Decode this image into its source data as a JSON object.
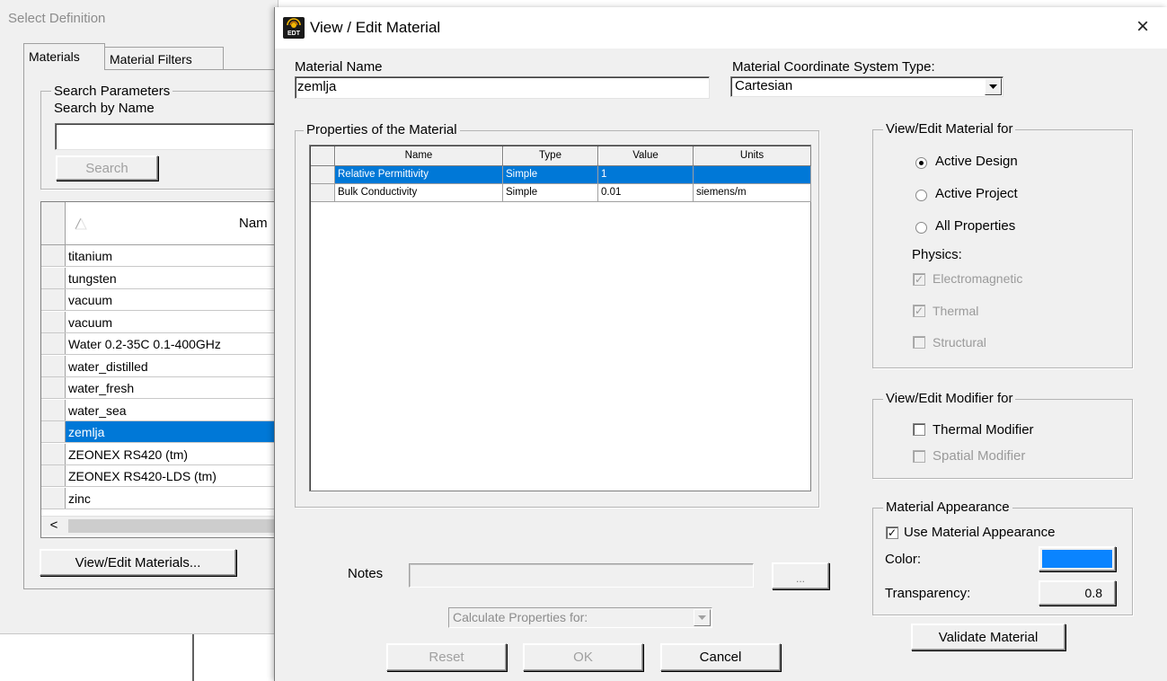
{
  "background_dialog": {
    "title": "Select Definition",
    "tabs": [
      {
        "label": "Materials"
      },
      {
        "label": "Material Filters"
      }
    ],
    "search_group": {
      "label": "Search Parameters",
      "search_by_name": "Search by Name",
      "search_input_value": "",
      "search_button": "Search"
    },
    "materials_table": {
      "name_header": "Nam",
      "rows": [
        {
          "name": "titanium"
        },
        {
          "name": "tungsten"
        },
        {
          "name": "vacuum"
        },
        {
          "name": "vacuum"
        },
        {
          "name": "Water 0.2-35C 0.1-400GHz"
        },
        {
          "name": "water_distilled"
        },
        {
          "name": "water_fresh"
        },
        {
          "name": "water_sea"
        },
        {
          "name": "zemlja",
          "selected": true
        },
        {
          "name": "ZEONEX RS420 (tm)"
        },
        {
          "name": "ZEONEX RS420-LDS (tm)"
        },
        {
          "name": "zinc"
        }
      ],
      "scroll_left_glyph": "<"
    },
    "view_edit_button": "View/Edit Materials..."
  },
  "dialog": {
    "title": "View / Edit Material",
    "app_icon_text": "EDT",
    "close_glyph": "×",
    "material_name_label": "Material Name",
    "material_name_value": "zemlja",
    "coord_label": "Material Coordinate System Type:",
    "coord_value": "Cartesian",
    "properties_group_label": "Properties of the Material",
    "properties_table": {
      "headers": [
        "Name",
        "Type",
        "Value",
        "Units"
      ],
      "rows": [
        {
          "name": "Relative Permittivity",
          "type": "Simple",
          "value": "1",
          "units": "",
          "selected": true
        },
        {
          "name": "Bulk Conductivity",
          "type": "Simple",
          "value": "0.01",
          "units": "siemens/m",
          "selected": false
        }
      ]
    },
    "view_edit_for": {
      "label": "View/Edit Material for",
      "options": [
        {
          "label": "Active Design",
          "selected": true
        },
        {
          "label": "Active Project",
          "selected": false
        },
        {
          "label": "All Properties",
          "selected": false
        }
      ],
      "physics_label": "Physics:",
      "physics": [
        {
          "label": "Electromagnetic",
          "checked": true
        },
        {
          "label": "Thermal",
          "checked": true
        },
        {
          "label": "Structural",
          "checked": false
        }
      ]
    },
    "modifier_for": {
      "label": "View/Edit Modifier for",
      "thermal": "Thermal Modifier",
      "spatial": "Spatial Modifier"
    },
    "appearance": {
      "label": "Material Appearance",
      "use_label": "Use Material Appearance",
      "use_checked": true,
      "color_label": "Color:",
      "color_value": "#0a84ff",
      "transparency_label": "Transparency:",
      "transparency_value": "0.8"
    },
    "validate_button": "Validate Material",
    "notes_label": "Notes",
    "notes_value": "",
    "notes_button": "...",
    "calculate_label": "Calculate Properties for:",
    "reset_button": "Reset",
    "ok_button": "OK",
    "cancel_button": "Cancel"
  }
}
